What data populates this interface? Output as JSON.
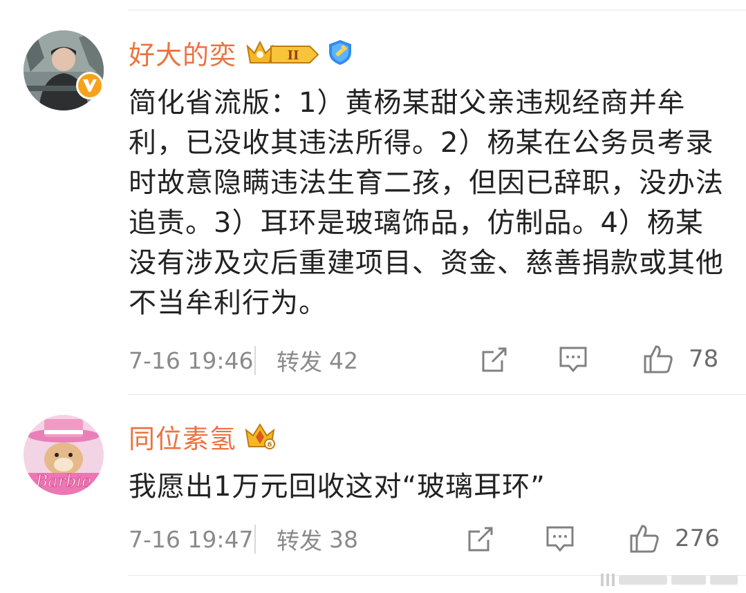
{
  "comments": [
    {
      "username": "好大的奕",
      "level_badge": "II",
      "verified_icon": "blue-shield-check-icon",
      "avatar_badge_icon": "orange-v-icon",
      "text": "简化省流版：1）黄杨某甜父亲违规经商并牟利，已没收其违法所得。2）杨某在公务员考录时故意隐瞒违法生育二孩，但因已辞职，没办法追责。3）耳环是玻璃饰品，仿制品。4）杨某没有涉及灾后重建项目、资金、慈善捐款或其他不当牟利行为。",
      "time": "7-16 19:46",
      "repost_label": "转发",
      "repost_count": "42",
      "like_count": "78"
    },
    {
      "username": "同位素氢",
      "level_badge": "crown-icon",
      "text": "我愿出1万元回收这对“玻璃耳环”",
      "time": "7-16 19:47",
      "repost_label": "转发",
      "repost_count": "38",
      "like_count": "276"
    }
  ],
  "colors": {
    "username": "#eb7340",
    "meta": "#8a8a8a",
    "text": "#222222",
    "divider": "#e8e8e8",
    "badge_gold": "#f5b823",
    "verified_blue": "#2f8cf0"
  }
}
